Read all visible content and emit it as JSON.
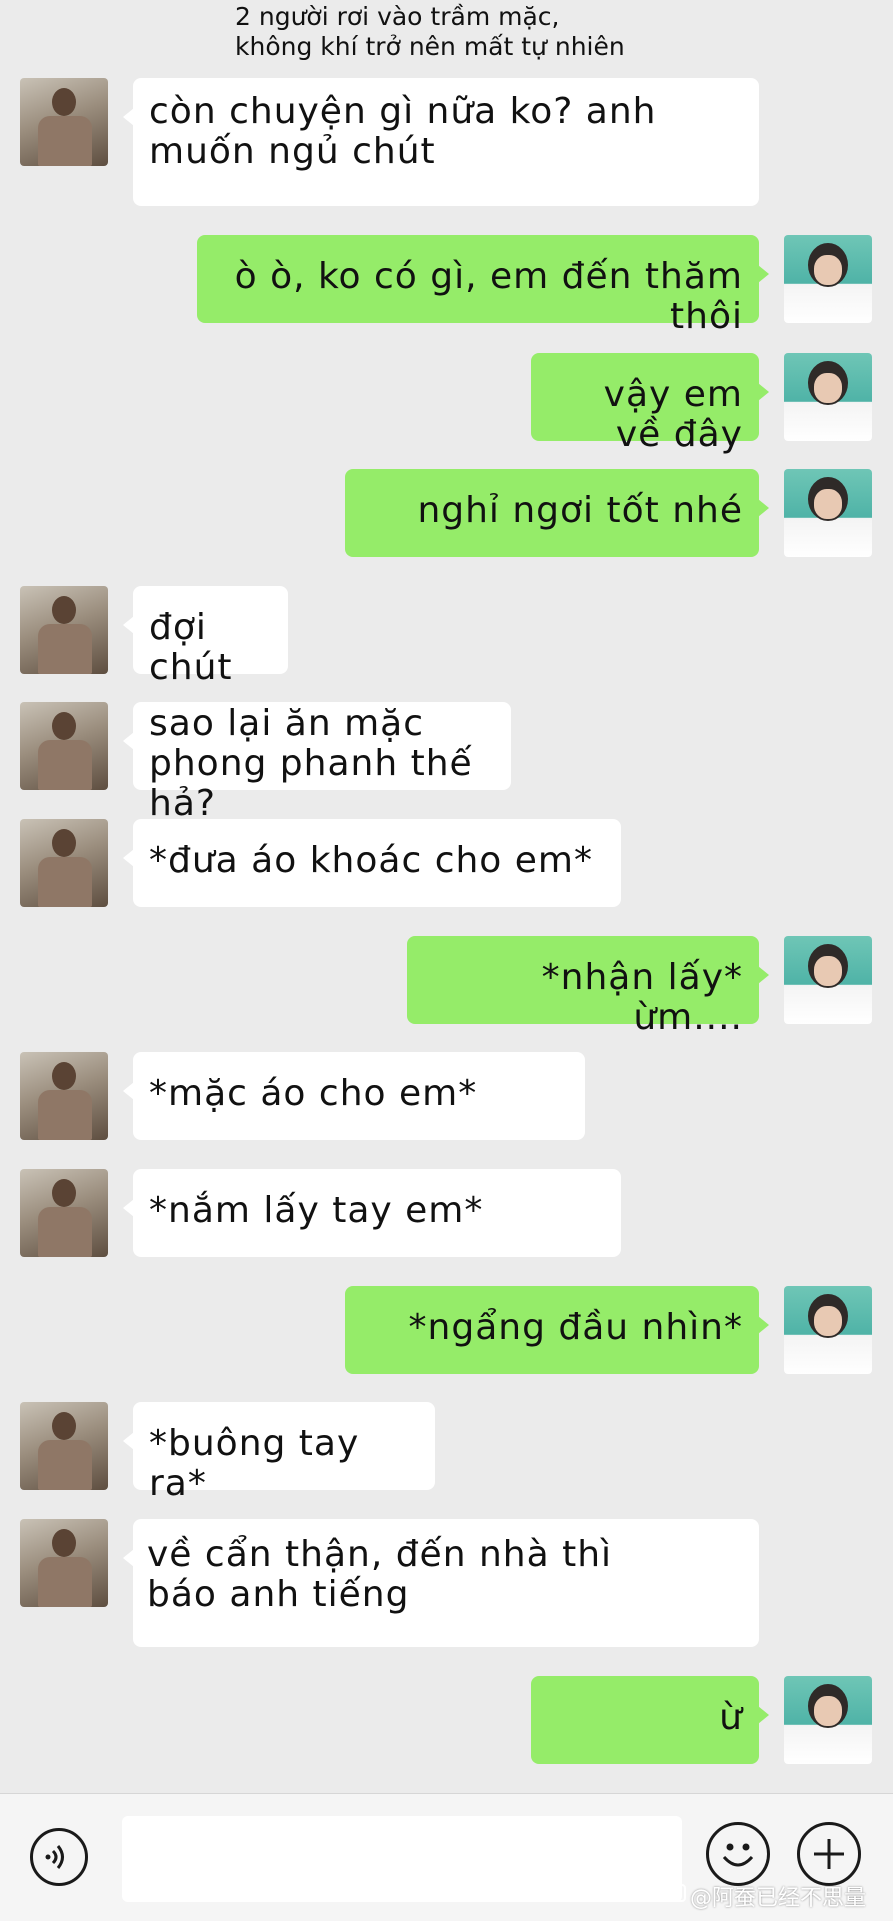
{
  "narration": {
    "line1": "2 người rơi vào trầm mặc,",
    "line2": "không khí trở nên mất tự nhiên"
  },
  "messages": [
    {
      "from": "him",
      "text": "còn chuyện gì nữa ko? anh\nmuốn ngủ chút"
    },
    {
      "from": "her",
      "text": "ò ò, ko có gì, em đến thăm thôi"
    },
    {
      "from": "her",
      "text": "vậy em về đây"
    },
    {
      "from": "her",
      "text": "nghỉ ngơi tốt nhé"
    },
    {
      "from": "him",
      "text": "đợi chút"
    },
    {
      "from": "him",
      "text": "sao lại ăn mặc\nphong phanh thế hả?"
    },
    {
      "from": "him",
      "text": "*đưa áo khoác cho em*"
    },
    {
      "from": "her",
      "text": "*nhận lấy* ừm...."
    },
    {
      "from": "him",
      "text": "*mặc áo cho em*"
    },
    {
      "from": "him",
      "text": "*nắm lấy tay em*"
    },
    {
      "from": "her",
      "text": "*ngẩng đầu nhìn*"
    },
    {
      "from": "him",
      "text": "*buông tay ra*"
    },
    {
      "from": "him",
      "text": "về cẩn thận, đến nhà thì\nbáo anh tiếng"
    },
    {
      "from": "her",
      "text": "ừ"
    }
  ],
  "input_bar": {
    "voice_icon": "voice-icon",
    "emoji_icon": "emoji-icon",
    "plus_icon": "plus-icon",
    "input_value": ""
  },
  "watermark": {
    "credit": "@阿蚕已经不思量"
  },
  "colors": {
    "background": "#ebebeb",
    "bubble_green": "#95ec69",
    "bubble_white": "#ffffff"
  }
}
